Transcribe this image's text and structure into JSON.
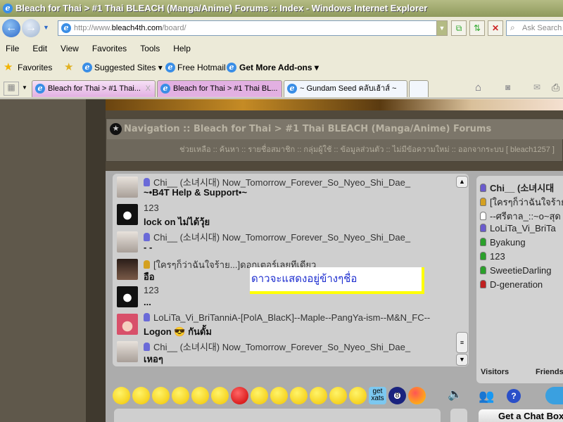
{
  "browser": {
    "title": "Bleach for Thai > #1 Thai BLEACH (Manga/Anime) Forums :: Index - Windows Internet Explorer",
    "url_prefix": "http://www.",
    "url_domain": "bleach4th.com",
    "url_path": "/board/",
    "search_placeholder": "Ask Search",
    "menu": [
      "File",
      "Edit",
      "View",
      "Favorites",
      "Tools",
      "Help"
    ],
    "favorites": {
      "label": "Favorites",
      "suggested": "Suggested Sites ▾",
      "hotmail": "Free Hotmail",
      "addons": "Get More Add-ons ▾"
    },
    "tabs": [
      {
        "label": "Bleach for Thai > #1 Thai...",
        "close": "X",
        "active": true
      },
      {
        "label": "Bleach for Thai > #1 Thai BL...",
        "active": false
      },
      {
        "label": "~ Gundam Seed คลับเฮ้าส์ ~",
        "active": false
      }
    ]
  },
  "forum": {
    "nav_title": "Navigation :: Bleach for Thai > #1 Thai BLEACH (Manga/Anime) Forums",
    "nav_links": "ช่วยเหลือ :: ค้นหา :: รายชื่อสมาชิก :: กลุ่มผู้ใช้ :: ข้อมูลส่วนตัว :: ไม่มีข้อความใหม่ :: ออกจากระบบ [ bleach1257 ]"
  },
  "chat": {
    "messages": [
      {
        "name": "Chi__ (소녀시대) Now_Tomorrow_Forever_So_Nyeo_Shi_Dae_",
        "text": "~•B4T Help & Support•~",
        "rank": "blue",
        "avatar": "girl"
      },
      {
        "name": "123",
        "text": "lock on ไม่ได้วุ้ย",
        "rank": "",
        "avatar": "cat"
      },
      {
        "name": "Chi__ (소녀시대) Now_Tomorrow_Forever_So_Nyeo_Shi_Dae_",
        "text": "- -",
        "rank": "blue",
        "avatar": "girl"
      },
      {
        "name": "[ใครๆก็ว่าฉันใจร้าย...]ดอกเตอร์เลยทีเดียว",
        "text": "อือ",
        "rank": "gold",
        "avatar": "dark"
      },
      {
        "name": "123",
        "text": "...",
        "rank": "",
        "avatar": "cat"
      },
      {
        "name": "LoLiTa_Vi_BriTanniA-[PolA_BlacK]--Maple--PangYa-ism--M&N_FC--",
        "text": "Logon  😎  กันดั้ม",
        "rank": "blue",
        "avatar": "red"
      },
      {
        "name": "Chi__ (소녀시대) Now_Tomorrow_Forever_So_Nyeo_Shi_Dae_",
        "text": "เหอๆ",
        "rank": "blue",
        "avatar": "girl"
      }
    ],
    "tooltip": "ดาวจะแสดงอยู่ข้างๆชื่อ",
    "visitors": [
      {
        "name": "Chi__ (소녀시대",
        "color": "#6a5acd",
        "bold": true
      },
      {
        "name": "[ใครๆก็ว่าฉันใจร้าย",
        "color": "#d4a020",
        "bold": false
      },
      {
        "name": "--ศรีตาล_::~o~สุด",
        "color": "#ffffff",
        "bold": false
      },
      {
        "name": "LoLiTa_Vi_BriTa",
        "color": "#6a5acd",
        "bold": false
      },
      {
        "name": "Byakung",
        "color": "#2aa02a",
        "bold": false
      },
      {
        "name": "123",
        "color": "#2aa02a",
        "bold": false
      },
      {
        "name": "SweetieDarling",
        "color": "#2aa02a",
        "bold": false
      },
      {
        "name": "D-generation",
        "color": "#c02020",
        "bold": false
      }
    ],
    "tab_visitors": "Visitors",
    "tab_friends": "Friends",
    "get_xats": "get xats",
    "eightball": "8",
    "get_chat_box": "Get a Chat Box"
  }
}
